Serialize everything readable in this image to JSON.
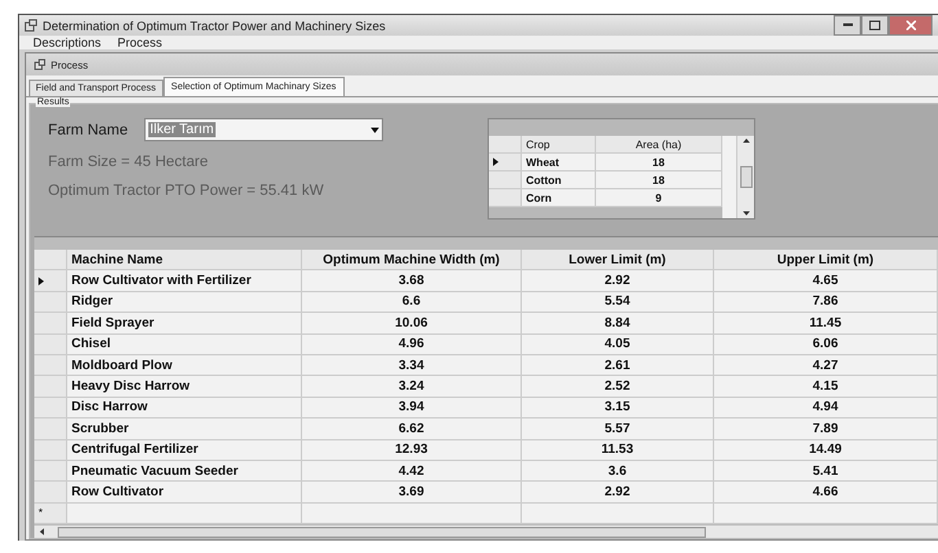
{
  "window": {
    "title": "Determination of Optimum Tractor Power and Machinery Sizes"
  },
  "menu": [
    "Descriptions",
    "Process"
  ],
  "child_window": {
    "title": "Process"
  },
  "tabs": [
    {
      "label": "Field and Transport Process",
      "selected": false
    },
    {
      "label": "Selection of Optimum Machinary Sizes",
      "selected": true
    }
  ],
  "results": {
    "title": "Results",
    "farm_name_label": "Farm Name",
    "farm_name_value": "Ilker Tarım",
    "farm_size": "Farm Size = 45 Hectare",
    "pto_power": "Optimum Tractor PTO Power =  55.41 kW",
    "crop_table": {
      "columns": [
        "Crop",
        "Area (ha)"
      ],
      "rows": [
        {
          "current": true,
          "cells": [
            "Wheat",
            "18"
          ]
        },
        {
          "current": false,
          "cells": [
            "Cotton",
            "18"
          ]
        },
        {
          "current": false,
          "cells": [
            "Corn",
            "9"
          ]
        }
      ]
    }
  },
  "machine_table": {
    "columns": [
      "Machine Name",
      "Optimum Machine Width (m)",
      "Lower Limit (m)",
      "Upper Limit (m)"
    ],
    "rows": [
      {
        "current": true,
        "cells": [
          "Row Cultivator with Fertilizer",
          "3.68",
          "2.92",
          "4.65"
        ]
      },
      {
        "current": false,
        "cells": [
          "Ridger",
          "6.6",
          "5.54",
          "7.86"
        ]
      },
      {
        "current": false,
        "cells": [
          "Field Sprayer",
          "10.06",
          "8.84",
          "11.45"
        ]
      },
      {
        "current": false,
        "cells": [
          "Chisel",
          "4.96",
          "4.05",
          "6.06"
        ]
      },
      {
        "current": false,
        "cells": [
          "Moldboard Plow",
          "3.34",
          "2.61",
          "4.27"
        ]
      },
      {
        "current": false,
        "cells": [
          "Heavy Disc Harrow",
          "3.24",
          "2.52",
          "4.15"
        ]
      },
      {
        "current": false,
        "cells": [
          "Disc Harrow",
          "3.94",
          "3.15",
          "4.94"
        ]
      },
      {
        "current": false,
        "cells": [
          "Scrubber",
          "6.62",
          "5.57",
          "7.89"
        ]
      },
      {
        "current": false,
        "cells": [
          "Centrifugal Fertilizer",
          "12.93",
          "11.53",
          "14.49"
        ]
      },
      {
        "current": false,
        "cells": [
          "Pneumatic Vacuum Seeder",
          "4.42",
          "3.6",
          "5.41"
        ]
      },
      {
        "current": false,
        "cells": [
          "Row Cultivator",
          "3.69",
          "2.92",
          "4.66"
        ]
      }
    ],
    "new_row_marker": "*"
  }
}
